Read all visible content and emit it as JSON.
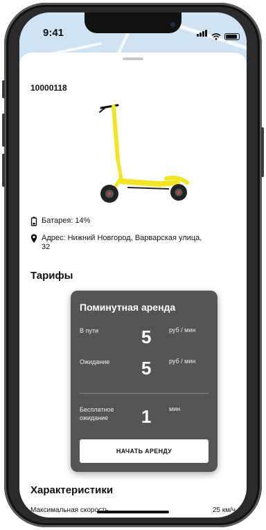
{
  "status_bar": {
    "time": "9:41"
  },
  "scooter": {
    "id": "10000118",
    "battery_text": "Батарея: 14%",
    "address_text": "Адрес: Нижний Новгород, Варварская улица, 32"
  },
  "tariffs": {
    "section_title": "Тарифы",
    "card_title": "Поминутная аренда",
    "rows": [
      {
        "label": "В пути",
        "value": "5",
        "unit": "руб / мин"
      },
      {
        "label": "Ожидание",
        "value": "5",
        "unit": "руб / мин"
      },
      {
        "label": "Бесплатное ожидание",
        "value": "1",
        "unit": "мин"
      }
    ],
    "start_button": "НАЧАТЬ АРЕНДУ"
  },
  "characteristics": {
    "section_title": "Характеристики",
    "items": [
      {
        "label": "Максимальная скорость",
        "value": "25 км/ч"
      }
    ]
  },
  "colors": {
    "card_bg": "#555555",
    "scooter_yellow": "#f3e61e",
    "map_bg": "#cfe3f2"
  },
  "icons": [
    "battery-icon",
    "location-pin-icon",
    "signal-icon",
    "wifi-icon",
    "battery-status-icon"
  ]
}
